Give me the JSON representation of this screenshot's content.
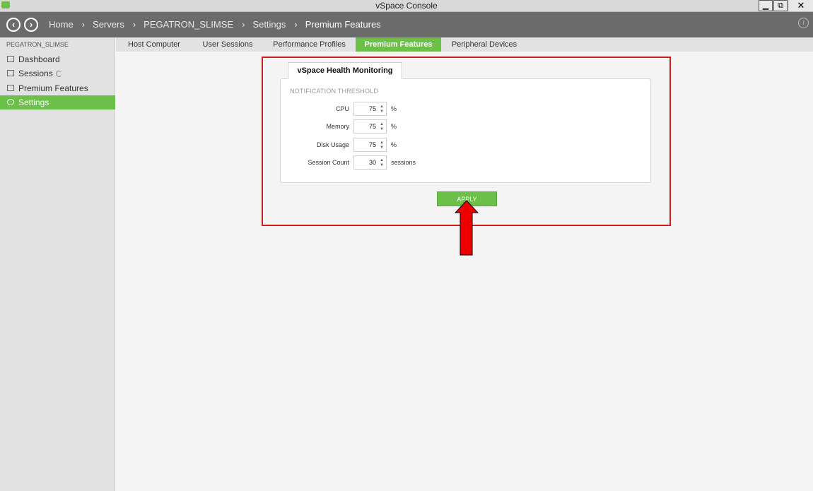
{
  "window": {
    "title": "vSpace Console",
    "minimize": "▁",
    "maximize": "⧉",
    "close": "✕"
  },
  "nav": {
    "back": "‹",
    "forward": "›",
    "breadcrumbs": [
      "Home",
      "Servers",
      "PEGATRON_SLIMSE",
      "Settings",
      "Premium Features"
    ],
    "separator": "›",
    "info": "i"
  },
  "sidebar": {
    "server_name": "PEGATRON_SLIMSE",
    "items": [
      {
        "label": "Dashboard",
        "icon": "dashboard-icon"
      },
      {
        "label": "Sessions",
        "icon": "sessions-icon"
      },
      {
        "label": "Premium Features",
        "icon": "premium-features-icon"
      },
      {
        "label": "Settings",
        "icon": "settings-icon",
        "active": true
      }
    ]
  },
  "tabs": [
    {
      "label": "Host Computer"
    },
    {
      "label": "User Sessions"
    },
    {
      "label": "Performance Profiles"
    },
    {
      "label": "Premium Features",
      "active": true
    },
    {
      "label": "Peripheral Devices"
    }
  ],
  "panel": {
    "tab_label": "vSpace Health Monitoring",
    "section_label": "NOTIFICATION THRESHOLD",
    "rows": [
      {
        "label": "CPU",
        "value": "75",
        "unit": "%"
      },
      {
        "label": "Memory",
        "value": "75",
        "unit": "%"
      },
      {
        "label": "Disk Usage",
        "value": "75",
        "unit": "%"
      },
      {
        "label": "Session Count",
        "value": "30",
        "unit": "sessions"
      }
    ],
    "apply_label": "APPLY",
    "spin_up": "▲",
    "spin_down": "▼"
  },
  "colors": {
    "accent": "#6cc04a",
    "navbar": "#6b6b6b",
    "highlight": "#cc1f1f",
    "arrow": "#ee0000"
  }
}
